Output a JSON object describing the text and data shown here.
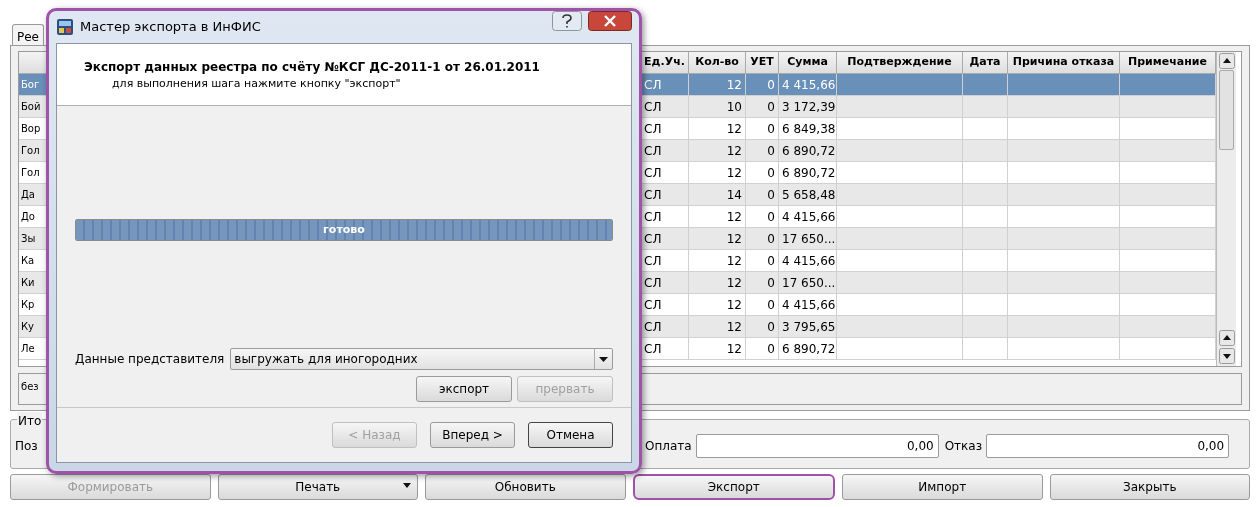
{
  "main_window": {
    "tab": {
      "label": "Рее",
      "selected": true
    },
    "table": {
      "columns": [
        {
          "label": "Ед.Уч."
        },
        {
          "label": "Кол-во"
        },
        {
          "label": "УЕТ"
        },
        {
          "label": "Сумма"
        },
        {
          "label": "Подтверждение"
        },
        {
          "label": "Дата"
        },
        {
          "label": "Причина отказа"
        },
        {
          "label": "Примечание"
        }
      ],
      "rows": [
        {
          "name": "Бог",
          "unit": "СЛ",
          "count": "12",
          "uet": "0",
          "sum": "4 415,66",
          "selected": true
        },
        {
          "name": "Бой",
          "unit": "СЛ",
          "count": "10",
          "uet": "0",
          "sum": "3 172,39",
          "selected": false
        },
        {
          "name": "Вор",
          "unit": "СЛ",
          "count": "12",
          "uet": "0",
          "sum": "6 849,38",
          "selected": false
        },
        {
          "name": "Гол",
          "unit": "СЛ",
          "count": "12",
          "uet": "0",
          "sum": "6 890,72",
          "selected": false
        },
        {
          "name": "Гол",
          "unit": "СЛ",
          "count": "12",
          "uet": "0",
          "sum": "6 890,72",
          "selected": false
        },
        {
          "name": "Да",
          "unit": "СЛ",
          "count": "14",
          "uet": "0",
          "sum": "5 658,48",
          "selected": false
        },
        {
          "name": "До",
          "unit": "СЛ",
          "count": "12",
          "uet": "0",
          "sum": "4 415,66",
          "selected": false
        },
        {
          "name": "Зы",
          "unit": "СЛ",
          "count": "12",
          "uet": "0",
          "sum": "17 650...",
          "selected": false
        },
        {
          "name": "Ка",
          "unit": "СЛ",
          "count": "12",
          "uet": "0",
          "sum": "4 415,66",
          "selected": false
        },
        {
          "name": "Ки",
          "unit": "СЛ",
          "count": "12",
          "uet": "0",
          "sum": "17 650...",
          "selected": false
        },
        {
          "name": "Кр",
          "unit": "СЛ",
          "count": "12",
          "uet": "0",
          "sum": "4 415,66",
          "selected": false
        },
        {
          "name": "Ку",
          "unit": "СЛ",
          "count": "12",
          "uet": "0",
          "sum": "3 795,65",
          "selected": false
        },
        {
          "name": "Ле",
          "unit": "СЛ",
          "count": "12",
          "uet": "0",
          "sum": "6 890,72",
          "selected": false
        }
      ]
    },
    "note_box": {
      "text": "без"
    },
    "totals": {
      "title": "Ито",
      "label": "Поз",
      "fields": [
        {
          "label": "Оплата",
          "value": "0,00"
        },
        {
          "label": "Отказ",
          "value": "0,00"
        }
      ]
    },
    "buttons": [
      {
        "label": "Формировать",
        "kind": "plain",
        "disabled": true,
        "highlighted": false
      },
      {
        "label": "Печать",
        "kind": "dropdown",
        "disabled": false,
        "highlighted": false
      },
      {
        "label": "Обновить",
        "kind": "plain",
        "disabled": false,
        "highlighted": false
      },
      {
        "label": "Экспорт",
        "kind": "plain",
        "disabled": false,
        "highlighted": true
      },
      {
        "label": "Импорт",
        "kind": "plain",
        "disabled": false,
        "highlighted": false
      },
      {
        "label": "Закрыть",
        "kind": "plain",
        "disabled": false,
        "highlighted": false
      }
    ]
  },
  "dialog": {
    "title": "Мастер экспорта в ИнФИС",
    "heading": "Экспорт данных реестра по счёту №КСГ ДС-2011-1 от 26.01.2011",
    "subheading": "для выполнения шага нажмите кнопку \"экспорт\"",
    "progress": {
      "label": "готово",
      "level": 1
    },
    "representative": {
      "label": "Данные представителя",
      "value": "выгружать для иногородних"
    },
    "step_buttons": [
      {
        "label": "экспорт",
        "disabled": false
      },
      {
        "label": "прервать",
        "disabled": true
      }
    ],
    "nav_buttons": [
      {
        "label": "< Назад",
        "disabled": true,
        "default": false
      },
      {
        "label": "Вперед >",
        "disabled": false,
        "default": false
      },
      {
        "label": "Отмена",
        "disabled": false,
        "default": true
      }
    ]
  }
}
